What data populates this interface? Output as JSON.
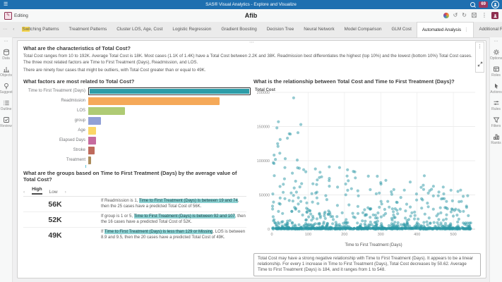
{
  "colors": {
    "appbar": "#1E6FB0",
    "badge": "#9C3A60",
    "profile": "#8E2E4F",
    "highlight": "#8FD3D4",
    "tab_highlight": "#F7D74E",
    "scatter_point": "#2B97A5"
  },
  "app_bar": {
    "hamburger": "☰",
    "title": "SAS® Visual Analytics - Explore and Visualize",
    "badge": "69"
  },
  "toolbar": {
    "mode": "Editing",
    "pencil": "✎",
    "report_title": "Afib",
    "undo": "↺",
    "redo": "↻",
    "more": "⋮"
  },
  "tab_bar": {
    "overflow_left": "⋯",
    "scroll_left": "‹",
    "scroll_right": "›",
    "add": "+",
    "overflow_right": "⋯",
    "tabs": [
      {
        "label": "Switching Patterns",
        "hl": 3
      },
      {
        "label": "Treatment Patterns"
      },
      {
        "label": "Cluster LOS, Age, Cost"
      },
      {
        "label": "Logistic Regression"
      },
      {
        "label": "Gradient Boosting"
      },
      {
        "label": "Decision Tree"
      },
      {
        "label": "Neural Network"
      },
      {
        "label": "Model Comparison"
      },
      {
        "label": "GLM Cost"
      },
      {
        "label": "Automated Analysis",
        "active": true,
        "menu": "⋮"
      },
      {
        "label": "Additional Reports"
      }
    ]
  },
  "left_rail": {
    "overflow": "⋯",
    "items": [
      {
        "label": "Data",
        "icon": "data-icon"
      },
      {
        "label": "Objects",
        "icon": "objects-icon"
      },
      {
        "label": "Suggest",
        "icon": "suggest-icon"
      },
      {
        "label": "Outline",
        "icon": "outline-icon"
      },
      {
        "label": "Review",
        "icon": "review-icon"
      }
    ]
  },
  "right_rail": {
    "overflow": "⋯",
    "items": [
      {
        "label": "Options",
        "icon": "options-icon"
      },
      {
        "label": "Roles",
        "icon": "roles-icon"
      },
      {
        "label": "Actions",
        "icon": "actions-icon"
      },
      {
        "label": "Rules",
        "icon": "rules-icon"
      },
      {
        "label": "Filters",
        "icon": "filters-icon"
      },
      {
        "label": "Ranks",
        "icon": "ranks-icon"
      }
    ]
  },
  "analysis": {
    "object_menu": "⋮",
    "q1": "What are the characteristics of Total Cost?",
    "p1": "Total Cost ranges from 10 to 192K. Average Total Cost is 18K. Most cases (1.1K of 1.4K) have a Total Cost between 2.2K and 38K. Readmission best differentiates the highest (top 10%) and the lowest (bottom 10%) Total Cost cases. The three most related factors are Time to First Treatment (Days), Readmission, and LOS.",
    "p2": "There are ninety four cases that might be outliers, with Total Cost greater than or equal to 49K.",
    "q2": "What factors are most related to Total Cost?",
    "q3": "What are the groups based on Time to First Treatment (Days) by the average value of Total Cost?",
    "q4": "What is the relationship between Total Cost and Time to First Treatment (Days)?",
    "caption": "Total Cost may have a strong negative relationship with Time to First Treatment (Days). It appears to be a linear relationship. For every 1 increase in Time to First Treatment (Days), Total Cost decreases by 50.62. Average Time to First Treatment (Days) is 184, and it ranges from 1 to 548.",
    "groups_tabs": {
      "prev": "‹",
      "high": "High",
      "low": "Low",
      "next": "›",
      "active": "High"
    },
    "rules": [
      {
        "value": "56K",
        "parts": [
          {
            "t": "If Readmission is 1, "
          },
          {
            "t": "Time to First Treatment (Days) is between 19 and 74",
            "h": true
          },
          {
            "t": ", then the 25 cases have a predicted Total Cost of 56K."
          }
        ]
      },
      {
        "value": "52K",
        "parts": [
          {
            "t": "If group is 1 or 5, "
          },
          {
            "t": "Time to First Treatment (Days) is between 92 and 107",
            "h": true
          },
          {
            "t": ", then the 16 cases have a predicted Total Cost of 52K."
          }
        ]
      },
      {
        "value": "49K",
        "parts": [
          {
            "t": "If "
          },
          {
            "t": "Time to First Treatment (Days) is less than 129 or Missing",
            "h": true
          },
          {
            "t": ", LOS is between 8.9 and 9.5, then the 20 cases have a predicted Total Cost of 49K."
          }
        ]
      }
    ]
  },
  "chart_data": [
    {
      "type": "bar",
      "orientation": "horizontal",
      "title": "What factors are most related to Total Cost?",
      "categories": [
        "Time to First Treatment (Days)",
        "Readmission",
        "LOS",
        "group",
        "Age",
        "Elapsed Days",
        "Stroke",
        "Treatment"
      ],
      "values": [
        1.0,
        0.81,
        0.225,
        0.077,
        0.048,
        0.046,
        0.037,
        0.016
      ],
      "colors": [
        "#2D9DA8",
        "#F5A959",
        "#AFCB74",
        "#91A0D6",
        "#FBD666",
        "#C66B9F",
        "#BE6A5C",
        "#AC8D5D"
      ],
      "selected_category": "Time to First Treatment (Days)",
      "xlabel": "",
      "ylabel": "",
      "value_axis_hidden": true
    },
    {
      "type": "scatter",
      "title": "What is the relationship between Total Cost and Time to First Treatment (Days)?",
      "xlabel": "Time to First Treatment (Days)",
      "ylabel": "Total Cost",
      "xlim": [
        0,
        560
      ],
      "ylim": [
        0,
        200000
      ],
      "x_ticks": [
        0,
        100,
        200,
        300,
        400,
        500
      ],
      "y_ticks": [
        0,
        50000,
        100000,
        150000,
        200000
      ],
      "grid": true,
      "n_cases": 1400,
      "x_data_range": [
        1,
        548
      ],
      "trend": "strong negative linear, slope -50.62",
      "outliers": [
        [
          60,
          192000
        ],
        [
          18,
          157000
        ],
        [
          80,
          153000
        ],
        [
          14,
          148000
        ],
        [
          72,
          141000
        ],
        [
          48,
          139500
        ],
        [
          51,
          139000
        ],
        [
          43,
          133000
        ],
        [
          23,
          131000
        ],
        [
          16,
          125000
        ],
        [
          17,
          121000
        ],
        [
          22,
          111000
        ],
        [
          37,
          103000
        ],
        [
          70,
          101000
        ],
        [
          4,
          97000
        ],
        [
          6,
          96000
        ],
        [
          36,
          90000
        ],
        [
          120,
          88000
        ],
        [
          230,
          75000
        ],
        [
          420,
          78000
        ],
        [
          300,
          68000
        ],
        [
          418,
          58000
        ],
        [
          365,
          57000
        ],
        [
          520,
          57000
        ]
      ],
      "generator": {
        "seed": 42,
        "n": 950,
        "x_max": 548,
        "y_scale": 108000,
        "y_pow": 7,
        "x_decay": 0.5,
        "jitter": 1500
      }
    }
  ]
}
